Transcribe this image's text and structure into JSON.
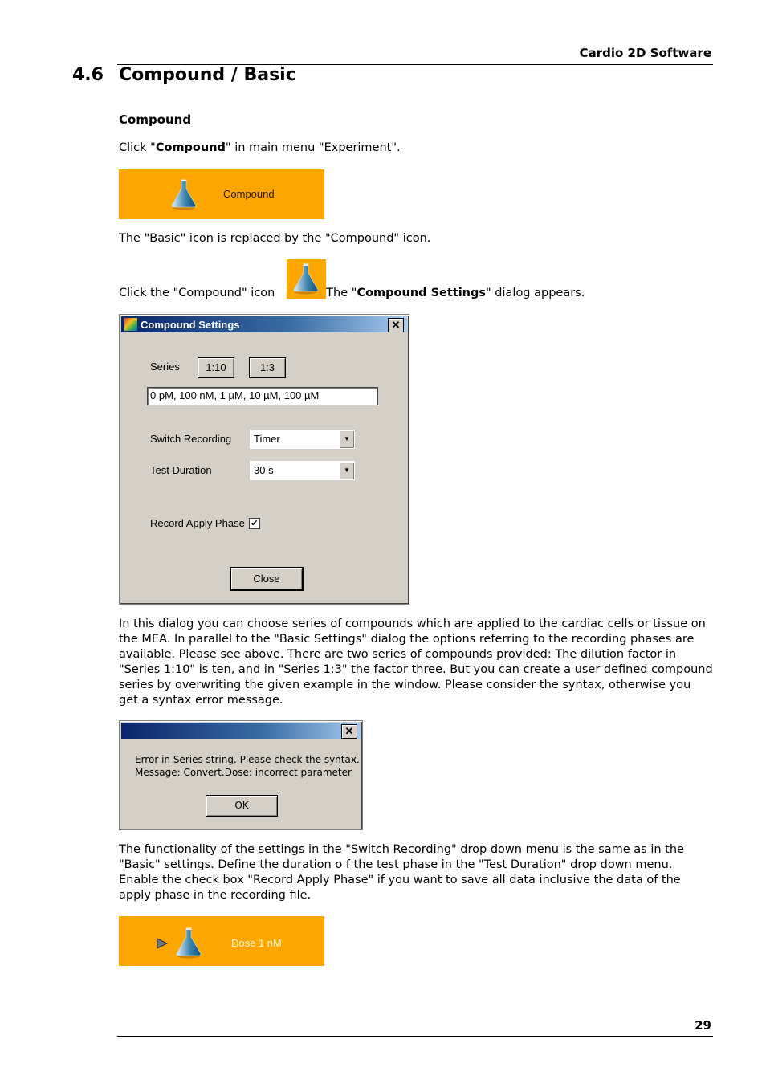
{
  "header": {
    "title": "Cardio 2D Software"
  },
  "section": {
    "number": "4.6",
    "title": "Compound / Basic"
  },
  "subheading": "Compound",
  "step1": {
    "pre": "Click \"",
    "bold": "Compound",
    "post": "\" in main menu \"Experiment\"."
  },
  "compound_banner": {
    "label": "Compound",
    "icon": "flask-icon",
    "bg_color": "#fda600"
  },
  "step2": "The \"Basic\" icon is replaced by the \"Compound\" icon.",
  "step3": {
    "pre": "Click the \"Compound\" icon ",
    "post_pre": ". The \"",
    "bold": "Compound Settings",
    "post": "\" dialog appears."
  },
  "settings_dialog": {
    "title": "Compound Settings",
    "series_label": "Series",
    "series_buttons": [
      "1:10",
      "1:3"
    ],
    "series_value": "0 pM, 100 nM, 1 µM, 10 µM, 100 µM",
    "switch_recording_label": "Switch Recording",
    "switch_recording_value": "Timer",
    "test_duration_label": "Test Duration",
    "test_duration_value": "30 s",
    "record_apply_label": "Record Apply Phase",
    "record_apply_checked": true,
    "close_label": "Close"
  },
  "para1": "In this dialog you can choose series of compounds which are applied to the cardiac cells or tissue on the MEA. In parallel to the \"Basic Settings\" dialog the options referring to the recording phases are available. Please see above. There are two series of compounds provided: The dilution factor in \"Series 1:10\" is ten, and in \"Series 1:3\" the factor three. But you can create a user defined compound series by overwriting the given example in the window. Please consider the syntax, otherwise you get a syntax error message.",
  "error_dialog": {
    "line1": "Error in Series string. Please check the syntax.",
    "line2": "Message: Convert.Dose: incorrect parameter",
    "ok_label": "OK"
  },
  "para2": "The functionality of the settings in the \"Switch Recording\" drop down menu is the same as in the \"Basic\" settings. Define the duration o f the test phase in the \"Test Duration\" drop down menu. Enable the check box \"Record Apply Phase\" if you want to save all data inclusive the data of the apply phase in the recording file.",
  "dose_banner": {
    "label": "Dose 1 nM",
    "icons": [
      "play-arrow-icon",
      "flask-icon"
    ]
  },
  "footer": {
    "page_number": "29"
  }
}
